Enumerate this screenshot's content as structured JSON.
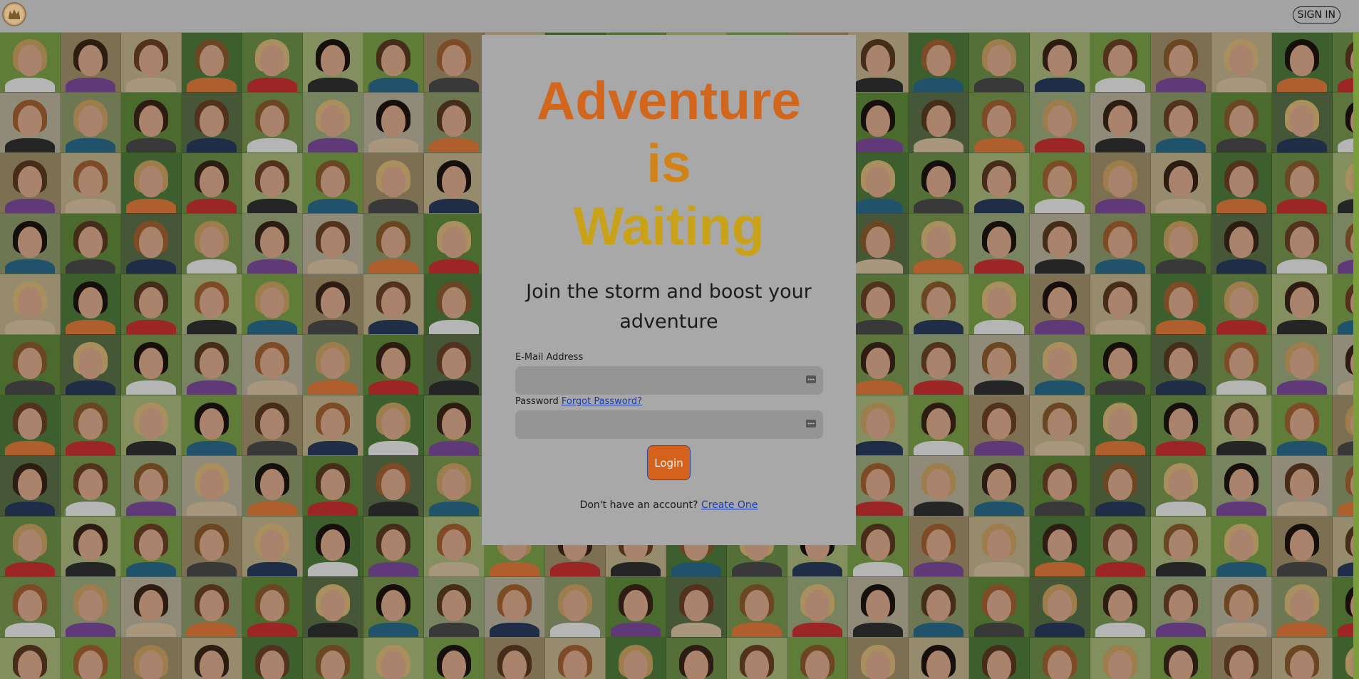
{
  "header": {
    "logo_icon": "crown-emblem-icon",
    "signin_label": "SIGN IN"
  },
  "hero": {
    "line1": "Adventure",
    "line2": "is",
    "line3": "Waiting",
    "subtitle": "Join the storm and boost your adventure",
    "colors": {
      "line1": "#d1661c",
      "line2": "#d28318",
      "line3": "#c9a21a"
    }
  },
  "form": {
    "email_label": "E-Mail Address",
    "email_value": "",
    "password_label": "Password",
    "forgot_link": "Forgot Password?",
    "password_value": "",
    "field_icon": "password-manager-key-icon",
    "login_label": "Login",
    "signup_prompt": "Don't have an account?",
    "signup_link": "Create One"
  },
  "background": {
    "description_icon": "portrait-mosaic",
    "accent_color": "#d4621d"
  }
}
